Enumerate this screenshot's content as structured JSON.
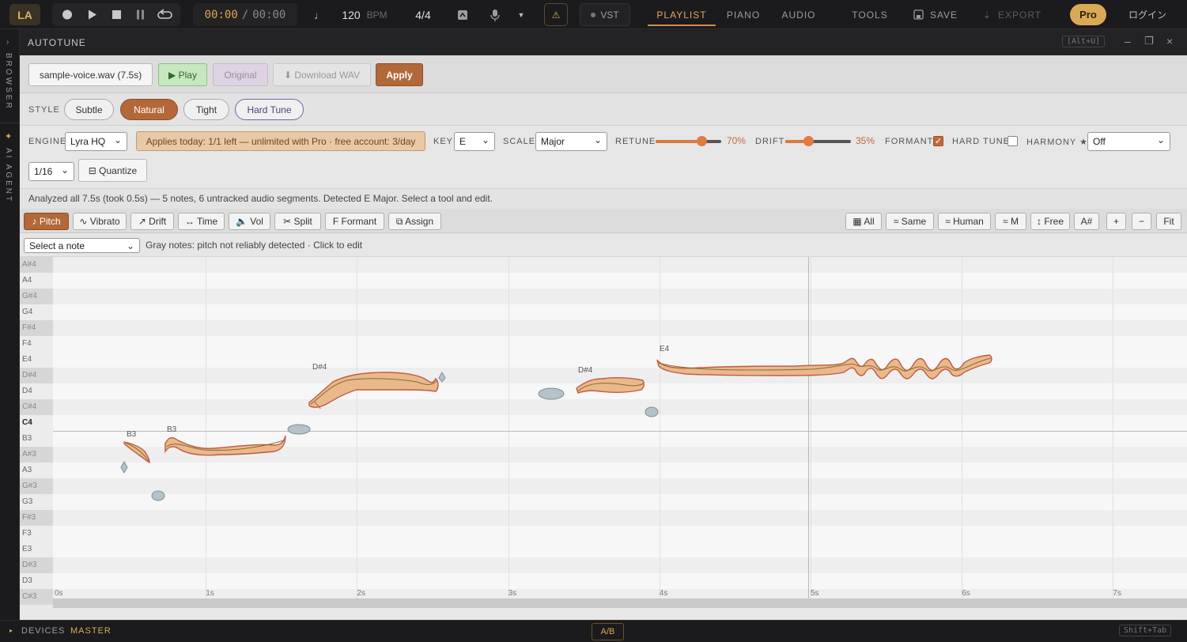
{
  "topbar": {
    "logo": "LA",
    "time_current": "00:00",
    "time_sep": "/",
    "time_total": "00:00",
    "bpm_value": "120",
    "bpm_unit": "BPM",
    "time_signature": "4/4",
    "vst_label": "VST",
    "tabs": [
      "PLAYLIST",
      "PIANO",
      "AUDIO"
    ],
    "tools_label": "TOOLS",
    "save_label": "SAVE",
    "export_label": "EXPORT",
    "pro_label": "Pro",
    "login_label": "ログイン"
  },
  "sidebar": {
    "browser_label": "BROWSER",
    "agent_label": "AI AGENT"
  },
  "panel": {
    "title": "AUTOTUNE",
    "shortcut": "[Alt+U]",
    "file_label": "sample-voice.wav (7.5s)",
    "play_label": "▶ Play",
    "original_label": "Original",
    "download_label": "⬇ Download WAV",
    "apply_label": "Apply",
    "style_label": "STYLE",
    "styles": [
      "Subtle",
      "Natural",
      "Tight",
      "Hard Tune"
    ],
    "engine_label": "ENGINE",
    "engine_value": "Lyra HQ",
    "notice": "Applies today: 1/1 left — unlimited with Pro · free account: 3/day",
    "key_label": "KEY",
    "key_value": "E",
    "scale_label": "SCALE",
    "scale_value": "Major",
    "retune_label": "RETUNE",
    "retune_value": "70%",
    "retune_level": 0.7,
    "drift_label": "DRIFT",
    "drift_value": "35%",
    "drift_level": 0.35,
    "formant_label": "FORMANT",
    "formant_checked": true,
    "hardtune_label": "HARD TUNE",
    "hardtune_checked": false,
    "harmony_label": "HARMONY ★",
    "harmony_value": "Off",
    "grid_value": "1/16",
    "quantize_label": "⊟ Quantize",
    "status": "Analyzed all 7.5s (took 0.5s) — 5 notes, 6 untracked audio segments. Detected E Major. Select a tool and edit.",
    "tools": [
      "♪ Pitch",
      "∿ Vibrato",
      "↗ Drift",
      "↔ Time",
      "🔈 Vol",
      "✂ Split",
      "F Formant",
      "⧉ Assign"
    ],
    "right_tools": [
      "▦ All",
      "≈ Same",
      "≈ Human",
      "≈ M",
      "↕ Free",
      "A#",
      "+",
      "−",
      "Fit"
    ],
    "note_select_placeholder": "Select a note",
    "hint": "Gray notes: pitch not reliably detected · Click to edit"
  },
  "roll": {
    "keys": [
      "A#4",
      "A4",
      "G#4",
      "G4",
      "F#4",
      "F4",
      "E4",
      "D#4",
      "D4",
      "C#4",
      "C4",
      "B3",
      "A#3",
      "A3",
      "G#3",
      "G3",
      "F#3",
      "F3",
      "E3",
      "D#3",
      "D3",
      "C#3"
    ],
    "ticks": [
      "0s",
      "1s",
      "2s",
      "3s",
      "4s",
      "5s",
      "6s",
      "7s"
    ],
    "note_labels": [
      "B3",
      "B3",
      "D#4",
      "D#4",
      "E4"
    ]
  },
  "bottombar": {
    "devices_label": "DEVICES",
    "master_label": "MASTER",
    "ab_label": "A/B",
    "shortcut": "Shift+Tab"
  },
  "colors": {
    "accent": "#b3683a",
    "pro": "#d9a957",
    "note_fill": "#e9b98a",
    "note_edge": "#c05a4a",
    "note_line": "#8a6a30"
  }
}
